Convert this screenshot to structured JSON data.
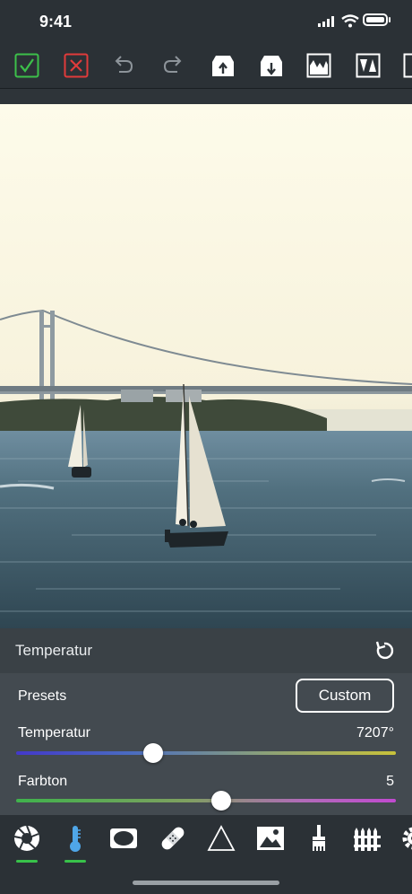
{
  "status_bar": {
    "time": "9:41"
  },
  "toolbar": {
    "buttons": [
      "confirm-icon",
      "cancel-icon",
      "undo-icon",
      "redo-icon",
      "export-up-icon",
      "import-down-icon",
      "histogram-icon",
      "levels-icon",
      "more-icon"
    ]
  },
  "panel": {
    "title": "Temperatur",
    "presets_label": "Presets",
    "preset_value": "Custom",
    "sliders": [
      {
        "label": "Temperatur",
        "value": "7207°",
        "level": 0.36
      },
      {
        "label": "Farbton",
        "value": "5",
        "level": 0.54
      }
    ]
  },
  "bottom_tools": {
    "items": [
      "aperture-icon",
      "thermometer-icon",
      "vignette-icon",
      "bandage-icon",
      "triangle-icon",
      "landscape-icon",
      "brush-icon",
      "fence-icon",
      "gear-icon"
    ],
    "active": [
      0,
      1
    ],
    "colors": {
      "active": "#38c24a",
      "thermometer": "#4fa6e8"
    }
  }
}
